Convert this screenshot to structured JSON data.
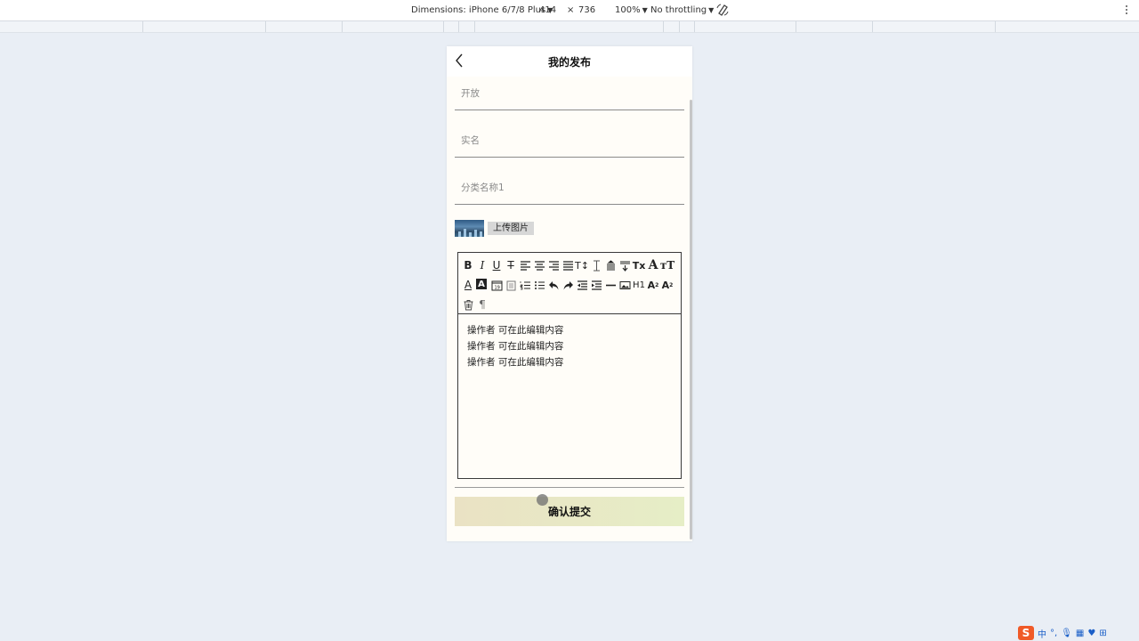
{
  "devtools": {
    "dimensions_label": "Dimensions: iPhone 6/7/8 Plus",
    "width": "414",
    "times": "×",
    "height": "736",
    "zoom": "100%",
    "throttling": "No throttling"
  },
  "page": {
    "title": "我的发布",
    "fields": [
      {
        "placeholder": "开放"
      },
      {
        "placeholder": "实名"
      },
      {
        "placeholder": "分类名称1"
      }
    ],
    "upload_label": "上传图片",
    "editor": {
      "toolbar_icons": [
        "bold-icon",
        "italic-icon",
        "underline-icon",
        "strikethrough-icon",
        "align-left-icon",
        "align-center-icon",
        "align-right-icon",
        "align-justify-icon",
        "font-size-icon",
        "line-height-icon",
        "paragraph-spacing-icon",
        "indent-format-icon",
        "clear-format-icon",
        "font-icon",
        "font-size-large-icon",
        "font-color-icon",
        "background-color-icon",
        "date-icon",
        "clipboard-icon",
        "ordered-list-icon",
        "unordered-list-icon",
        "undo-icon",
        "redo-icon",
        "outdent-icon",
        "indent-icon",
        "horizontal-rule-icon",
        "image-icon",
        "heading-icon",
        "subscript-icon",
        "superscript-icon",
        "delete-icon",
        "pilcrow-icon"
      ],
      "lines": [
        "操作者  可在此编辑内容",
        "操作者  可在此编辑内容",
        "操作者  可在此编辑内容"
      ]
    },
    "submit_label": "确认提交"
  },
  "tray": {
    "ime": "中",
    "s_logo": "S"
  }
}
